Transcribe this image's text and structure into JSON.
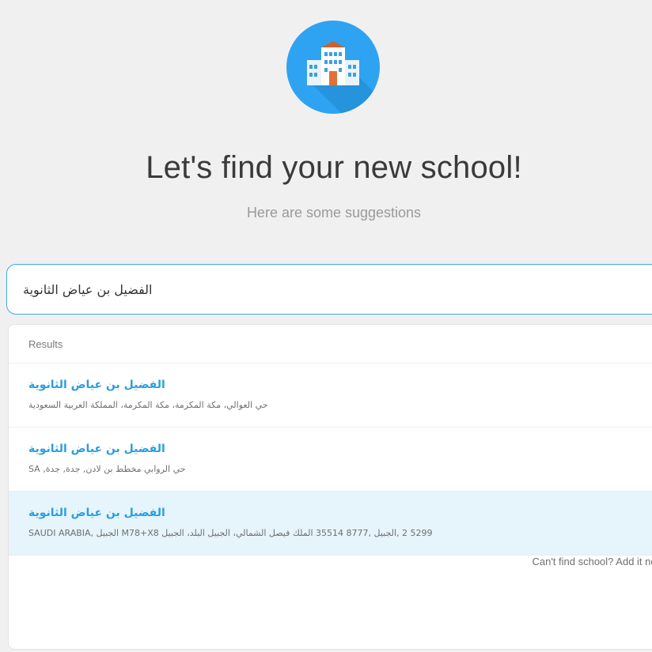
{
  "header": {
    "icon": "school-building-icon",
    "title": "Let's find your new school!",
    "subtitle": "Here are some suggestions"
  },
  "search": {
    "value": "الفضيل بن عياض الثانوية"
  },
  "results": {
    "header": "Results",
    "items": [
      {
        "name": "الفضيل بن عياض الثانوية",
        "address": "حي العوالي، مكة المكرمة، مكة المكرمة، المملكة العربية السعودية"
      },
      {
        "name": "الفضيل بن عياض الثانوية",
        "address": "SA ,حي الروابي مخطط بن لادن, جدة, جدة"
      },
      {
        "name": "الفضيل بن عياض الثانوية",
        "address": "5299 2 ,الجبيل ,8777 35514 الملك فيصل الشمالي، الجبيل البلد، الجبيل M78+X8 الجبيل ,SAUDI ARABIA"
      }
    ],
    "add_link": "Can't find school? Add it now"
  },
  "colors": {
    "accent": "#2ea3f2",
    "result_name": "#2a9ee0",
    "selected_row": "#e6f4fb"
  }
}
